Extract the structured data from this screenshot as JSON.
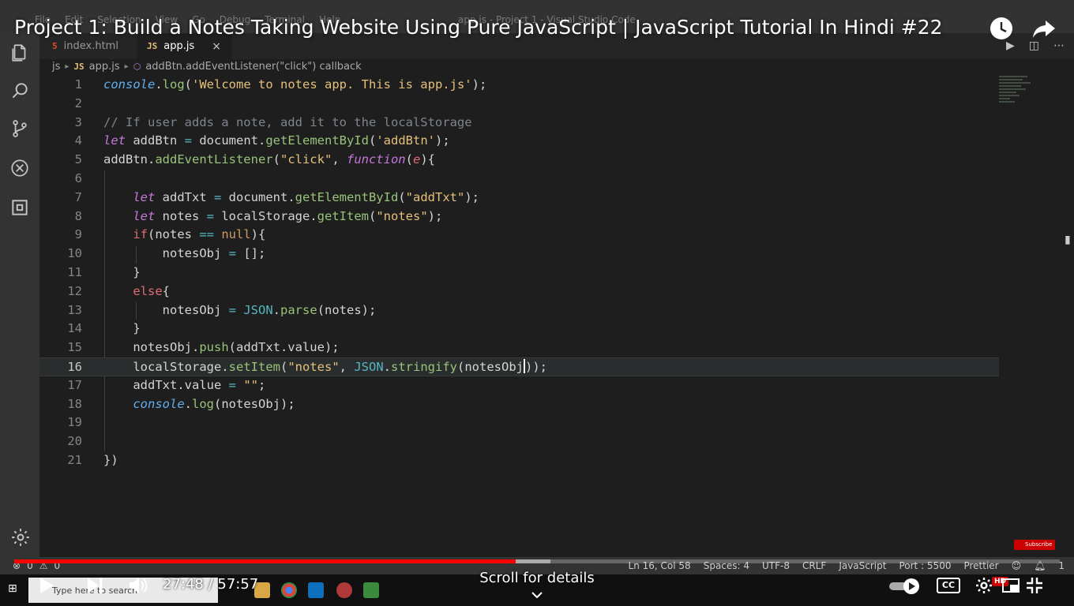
{
  "video": {
    "title": "Project 1: Build a Notes Taking Website Using Pure JavaScript | JavaScript Tutorial In Hindi #22",
    "current_time": "27:48",
    "separator": " / ",
    "duration": "57:57",
    "progress_fraction": 0.4798,
    "buffered_fraction": 0.5125,
    "scroll_hint": "Scroll for details",
    "subscribe_label": "Subscribe",
    "hd_badge": "HD",
    "cc_label": "CC",
    "colors": {
      "played": "#ff0000"
    },
    "icons": [
      "clock-icon",
      "share-icon",
      "play-icon",
      "next-icon",
      "volume-icon",
      "autoplay-toggle-icon",
      "settings-icon",
      "miniplayer-icon",
      "fullscreen-exit-icon",
      "chevron-down-icon"
    ]
  },
  "vscode": {
    "menu": [
      "File",
      "Edit",
      "Selection",
      "View",
      "Go",
      "Debug",
      "Terminal",
      "Help"
    ],
    "window_title": "app.js - Project 1 - Visual Studio Code",
    "tabs": [
      {
        "label": "index.html",
        "icon": "5",
        "active": false
      },
      {
        "label": "app.js",
        "icon": "JS",
        "active": true,
        "close": "×"
      }
    ],
    "breadcrumb": {
      "folder": "js",
      "file_icon": "JS",
      "file": "app.js",
      "symbol": "addBtn.addEventListener(\"click\") callback"
    },
    "status": {
      "errors": "0",
      "warnings": "0",
      "position": "Ln 16, Col 58",
      "spaces": "Spaces: 4",
      "encoding": "UTF-8",
      "eol": "CRLF",
      "language": "JavaScript",
      "port": "Port : 5500",
      "formatter": "Prettier",
      "notifications": "1"
    },
    "current_line": 16
  },
  "taskbar": {
    "search_placeholder": "Type here to search"
  },
  "code": [
    {
      "n": "1",
      "i": 0,
      "t": [
        [
          "objit",
          "console"
        ],
        [
          "p",
          "."
        ],
        [
          "fn",
          "log"
        ],
        [
          "p",
          "("
        ],
        [
          "str",
          "'Welcome to notes app. This is app.js'"
        ],
        [
          "p",
          ");"
        ]
      ]
    },
    {
      "n": "2",
      "i": 0,
      "t": []
    },
    {
      "n": "3",
      "i": 0,
      "t": [
        [
          "cmt",
          "// If user adds a note, add it to the localStorage"
        ]
      ]
    },
    {
      "n": "4",
      "i": 0,
      "t": [
        [
          "kw",
          "let"
        ],
        [
          "p",
          " addBtn "
        ],
        [
          "op",
          "="
        ],
        [
          "p",
          " document."
        ],
        [
          "fn",
          "getElementById"
        ],
        [
          "p",
          "("
        ],
        [
          "str",
          "'addBtn'"
        ],
        [
          "p",
          ");"
        ]
      ]
    },
    {
      "n": "5",
      "i": 0,
      "t": [
        [
          "p",
          "addBtn."
        ],
        [
          "fn",
          "addEventListener"
        ],
        [
          "p",
          "("
        ],
        [
          "str",
          "\"click\""
        ],
        [
          "p",
          ", "
        ],
        [
          "kw",
          "function"
        ],
        [
          "p",
          "("
        ],
        [
          "par",
          "e"
        ],
        [
          "p",
          "){"
        ]
      ]
    },
    {
      "n": "6",
      "i": 0,
      "t": []
    },
    {
      "n": "7",
      "i": 1,
      "t": [
        [
          "kw",
          "let"
        ],
        [
          "p",
          " addTxt "
        ],
        [
          "op",
          "="
        ],
        [
          "p",
          " document."
        ],
        [
          "fn",
          "getElementById"
        ],
        [
          "p",
          "("
        ],
        [
          "str",
          "\"addTxt\""
        ],
        [
          "p",
          ");"
        ]
      ]
    },
    {
      "n": "8",
      "i": 1,
      "t": [
        [
          "kw",
          "let"
        ],
        [
          "p",
          " notes "
        ],
        [
          "op",
          "="
        ],
        [
          "p",
          " localStorage."
        ],
        [
          "fn",
          "getItem"
        ],
        [
          "p",
          "("
        ],
        [
          "str",
          "\"notes\""
        ],
        [
          "p",
          ");"
        ]
      ]
    },
    {
      "n": "9",
      "i": 1,
      "t": [
        [
          "ctrl",
          "if"
        ],
        [
          "p",
          "(notes "
        ],
        [
          "op",
          "=="
        ],
        [
          "p",
          " "
        ],
        [
          "null",
          "null"
        ],
        [
          "p",
          "){"
        ]
      ]
    },
    {
      "n": "10",
      "i": 2,
      "t": [
        [
          "p",
          "notesObj "
        ],
        [
          "op",
          "="
        ],
        [
          "p",
          " [];"
        ]
      ]
    },
    {
      "n": "11",
      "i": 1,
      "t": [
        [
          "p",
          "}"
        ]
      ]
    },
    {
      "n": "12",
      "i": 1,
      "t": [
        [
          "ctrl",
          "else"
        ],
        [
          "p",
          "{"
        ]
      ]
    },
    {
      "n": "13",
      "i": 2,
      "t": [
        [
          "p",
          "notesObj "
        ],
        [
          "op",
          "="
        ],
        [
          "p",
          " "
        ],
        [
          "obj",
          "JSON"
        ],
        [
          "p",
          "."
        ],
        [
          "fn",
          "parse"
        ],
        [
          "p",
          "(notes);"
        ]
      ]
    },
    {
      "n": "14",
      "i": 1,
      "t": [
        [
          "p",
          "}"
        ]
      ]
    },
    {
      "n": "15",
      "i": 1,
      "t": [
        [
          "p",
          "notesObj."
        ],
        [
          "fn",
          "push"
        ],
        [
          "p",
          "(addTxt.value);"
        ]
      ]
    },
    {
      "n": "16",
      "i": 1,
      "t": [
        [
          "p",
          "localStorage."
        ],
        [
          "fn",
          "setItem"
        ],
        [
          "p",
          "("
        ],
        [
          "str",
          "\"notes\""
        ],
        [
          "p",
          ", "
        ],
        [
          "obj",
          "JSON"
        ],
        [
          "p",
          "."
        ],
        [
          "fn",
          "stringify"
        ],
        [
          "p",
          "(notesObj"
        ],
        [
          "cur",
          ""
        ],
        [
          "p",
          "));"
        ]
      ]
    },
    {
      "n": "17",
      "i": 1,
      "t": [
        [
          "p",
          "addTxt.value "
        ],
        [
          "op",
          "="
        ],
        [
          "p",
          " "
        ],
        [
          "str",
          "\"\""
        ],
        [
          "p",
          ";"
        ]
      ]
    },
    {
      "n": "18",
      "i": 1,
      "t": [
        [
          "objit",
          "console"
        ],
        [
          "p",
          "."
        ],
        [
          "fn",
          "log"
        ],
        [
          "p",
          "(notesObj);"
        ]
      ]
    },
    {
      "n": "19",
      "i": 0,
      "t": []
    },
    {
      "n": "20",
      "i": 0,
      "t": []
    },
    {
      "n": "21",
      "i": 0,
      "t": [
        [
          "p",
          "})"
        ]
      ]
    }
  ]
}
